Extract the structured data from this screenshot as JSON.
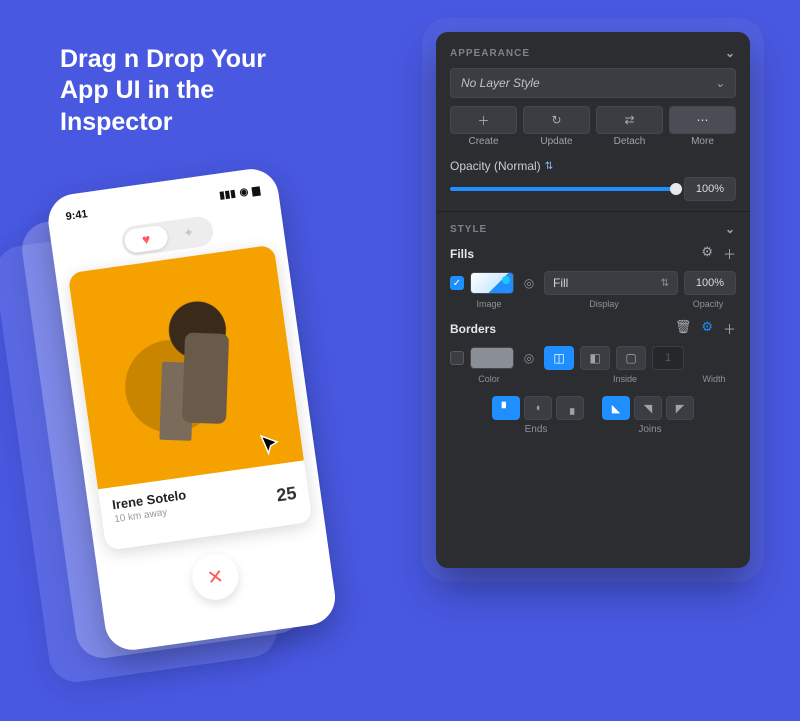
{
  "headline": "Drag n Drop Your App UI in the Inspector",
  "phone": {
    "time": "9:41",
    "card": {
      "name": "Irene Sotelo",
      "distance": "10 km away",
      "age": "25"
    }
  },
  "inspector": {
    "appearance": {
      "title": "Appearance",
      "layer_style": "No Layer Style",
      "buttons": {
        "create": "Create",
        "update": "Update",
        "detach": "Detach",
        "more": "More"
      },
      "opacity_label": "Opacity (Normal)",
      "opacity_value": "100%"
    },
    "style": {
      "title": "Style",
      "fills": {
        "title": "Fills",
        "image_label": "Image",
        "display_label": "Display",
        "display_value": "Fill",
        "opacity_label": "Opacity",
        "opacity_value": "100%"
      },
      "borders": {
        "title": "Borders",
        "color_label": "Color",
        "position_label": "Inside",
        "width_label": "Width",
        "width_value": "1"
      },
      "ends_label": "Ends",
      "joins_label": "Joins"
    }
  }
}
